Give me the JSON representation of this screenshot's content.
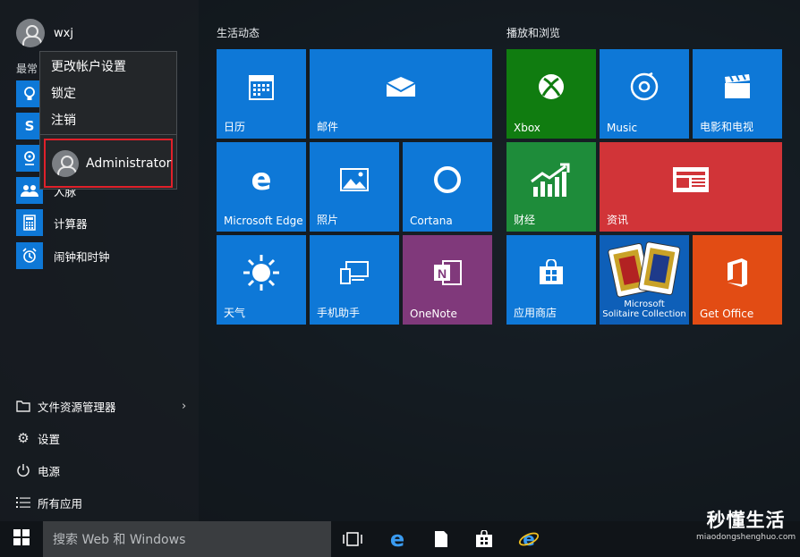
{
  "user": {
    "name": "wxj"
  },
  "left": {
    "most_used_label": "最常",
    "apps": [
      {
        "label": "",
        "icon": "lightbulb-icon"
      },
      {
        "label": "",
        "icon": "skype-icon"
      },
      {
        "label": "",
        "icon": "maps-icon"
      },
      {
        "label": "人脉",
        "icon": "people-icon"
      },
      {
        "label": "计算器",
        "icon": "calculator-icon"
      },
      {
        "label": "闹钟和时钟",
        "icon": "alarm-icon"
      }
    ],
    "bottom": [
      {
        "label": "文件资源管理器",
        "icon": "folder-icon"
      },
      {
        "label": "设置",
        "icon": "gear-icon"
      },
      {
        "label": "电源",
        "icon": "power-icon"
      },
      {
        "label": "所有应用",
        "icon": "list-icon"
      }
    ]
  },
  "popup": {
    "items": [
      "更改帐户设置",
      "锁定",
      "注销"
    ],
    "switch_user": "Administrator"
  },
  "groups": [
    {
      "title": "生活动态"
    },
    {
      "title": "播放和浏览"
    }
  ],
  "tiles": [
    {
      "label": "日历",
      "icon": "calendar-icon"
    },
    {
      "label": "邮件",
      "icon": "mail-icon"
    },
    {
      "label": "Microsoft Edge",
      "icon": "edge-icon"
    },
    {
      "label": "照片",
      "icon": "photos-icon"
    },
    {
      "label": "Cortana",
      "icon": "cortana-icon"
    },
    {
      "label": "天气",
      "icon": "weather-icon"
    },
    {
      "label": "手机助手",
      "icon": "phone-companion-icon"
    },
    {
      "label": "OneNote",
      "icon": "onenote-icon"
    },
    {
      "label": "Xbox",
      "icon": "xbox-icon"
    },
    {
      "label": "Music",
      "icon": "music-icon"
    },
    {
      "label": "电影和电视",
      "icon": "movies-icon"
    },
    {
      "label": "财经",
      "icon": "finance-icon"
    },
    {
      "label": "资讯",
      "icon": "news-icon"
    },
    {
      "label": "应用商店",
      "icon": "store-icon"
    },
    {
      "label": "Microsoft\nSolitaire Collection",
      "label_line1": "Microsoft",
      "label_line2": "Solitaire Collection",
      "icon": "solitaire-icon"
    },
    {
      "label": "Get Office",
      "icon": "office-icon"
    }
  ],
  "taskbar": {
    "search_placeholder": "搜索 Web 和 Windows",
    "icons": [
      "windows-logo-icon",
      "task-view-icon",
      "edge-icon",
      "file-icon",
      "store-icon",
      "ie-icon"
    ]
  },
  "watermark": {
    "title": "秒懂生活",
    "url": "miaodongshenghuo.com"
  },
  "colors": {
    "tile_blue": "#0e78d7",
    "xbox_green": "#107c10",
    "finance_green": "#1e8c3a",
    "news_red": "#d13438",
    "onenote_purple": "#80397b",
    "office_orange": "#e24c14",
    "highlight_red": "#e0202a"
  }
}
